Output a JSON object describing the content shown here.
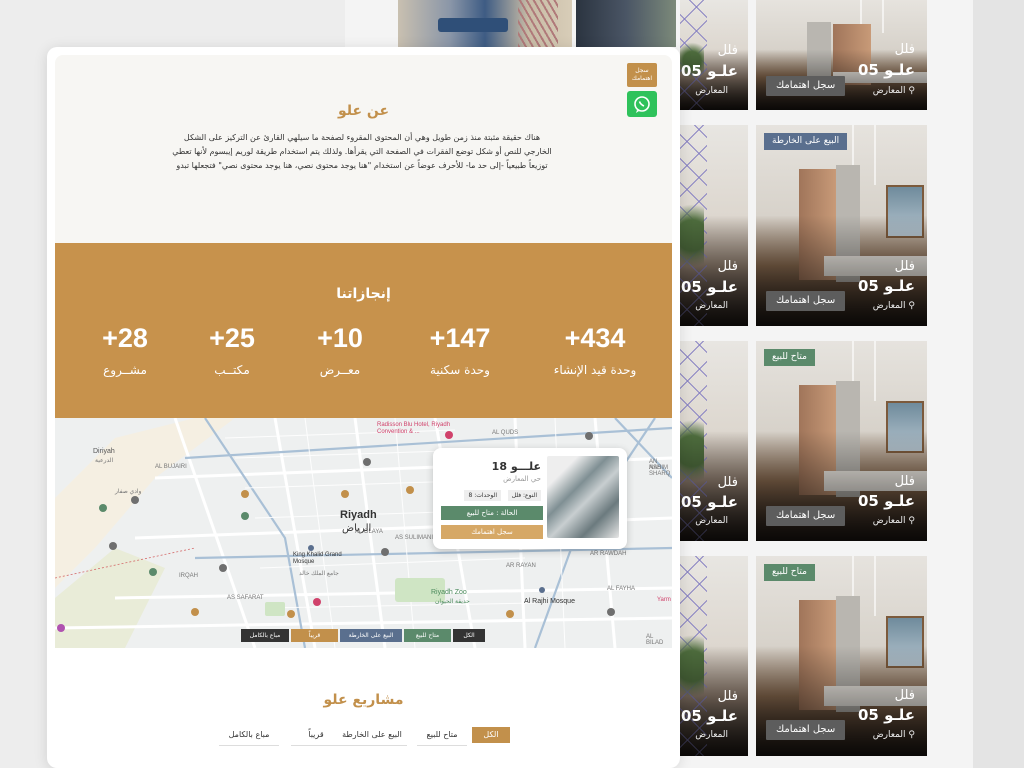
{
  "colors": {
    "accent": "#c2904b",
    "stats_bg": "#c7924c",
    "green": "#5b8a6b",
    "blue": "#5a6f8e",
    "dark": "#333333",
    "whatsapp": "#2fc25b"
  },
  "side_buttons": {
    "register": "سجل اهتمامك",
    "whatsapp_icon": "whatsapp-icon"
  },
  "about": {
    "title": "عن علو",
    "body": "هناك حقيقة مثبتة منذ زمن طويل وهي أن المحتوى المقروء لصفحة ما سيلهي القارئ عن التركيز على الشكل الخارجي للنص أو شكل توضع الفقرات في الصفحة التي يقرأها. ولذلك يتم استخدام طريقة لوريم إيبسوم لأنها تعطي توزيعاً طبيعياً -إلى حد ما- للأحرف عوضاً عن استخدام \"هنا يوجد محتوى نصي، هنا يوجد محتوى نصي\" فتجعلها تبدو"
  },
  "stats": {
    "title": "إنجازاتنا",
    "items": [
      {
        "value": "+434",
        "label": "وحدة قيد الإنشاء"
      },
      {
        "value": "+147",
        "label": "وحدة سكنية"
      },
      {
        "value": "+10",
        "label": "معــرض"
      },
      {
        "value": "+25",
        "label": "مكتــب"
      },
      {
        "value": "+28",
        "label": "مشــروع"
      }
    ]
  },
  "map": {
    "labels": {
      "riyadh_en": "Riyadh",
      "riyadh_ar": "الرياض",
      "diriyah": "Diriyah",
      "diriyah_ar": "الدرعية",
      "radisson": "Radisson Blu Hotel, Riyadh Convention & ...",
      "zoo": "Riyadh Zoo",
      "zoo_ar": "حديقة الحيوان",
      "rajhi": "Al Rajhi Mosque",
      "mosque": "King Khalid Grand Mosque",
      "mosque_ar": "جامع الملك خالد",
      "al_quds": "AL QUDS",
      "al_bujairi": "AL BUJAIRI",
      "irqah": "IRQAH",
      "as_sifarat": "AS SAFARAT",
      "al_olaya": "AL OLAYA",
      "al_faiha": "AL FAYHA",
      "ar_rawdah": "AR RAWDAH",
      "al_rayan": "AR RAYAN",
      "as_sulimaniyah": "AS SULIMANIYAH",
      "yarmouk": "Yarm",
      "wadi": "وادي صفار",
      "an_nasim": "AN NASIM",
      "ash_sharq": "ASH SHARQ",
      "al_bilad": "AL BILAD"
    },
    "popup": {
      "name": "علـــو 18",
      "location": "حي المعارض",
      "type": "النوع: فلل",
      "units": "الوحدات: 8",
      "status": "الحالة : متاح للبيع",
      "register": "سجل اهتمامك"
    },
    "filter_tabs": [
      "الكل",
      "متاح للبيع",
      "البيع على الخارطة",
      "قريباً",
      "مباع بالكامل"
    ]
  },
  "projects": {
    "title": "مشاريع علو",
    "filter_tabs": [
      "الكل",
      "متاح للبيع",
      "البيع على الخارطة",
      "قريباً",
      "مباع بالكامل"
    ]
  },
  "cards": [
    {
      "type": "فلل",
      "name": "علـو 05",
      "location": "المعارض",
      "button": "سجل اهتمامك",
      "badge": ""
    },
    {
      "type": "فلل",
      "name": "علـو 05",
      "location": "المعارض",
      "button": "سجل اهتمامك",
      "badge": "البيع على الخارطة"
    },
    {
      "type": "فلل",
      "name": "علـو 05",
      "location": "المعارض",
      "button": "سجل اهتمامك",
      "badge": "متاح للبيع"
    },
    {
      "type": "فلل",
      "name": "علـو 05",
      "location": "المعارض",
      "button": "سجل اهتمامك",
      "badge": "متاح للبيع"
    }
  ],
  "partial_cards": [
    {
      "type": "فلل",
      "name": "علـو 05",
      "location": "المعارض"
    },
    {
      "type": "فلل",
      "name": "علـو 05",
      "location": "المعارض"
    },
    {
      "type": "فلل",
      "name": "علـو 05",
      "location": "المعارض"
    },
    {
      "type": "فلل",
      "name": "علـو 05",
      "location": "المعارض"
    }
  ]
}
